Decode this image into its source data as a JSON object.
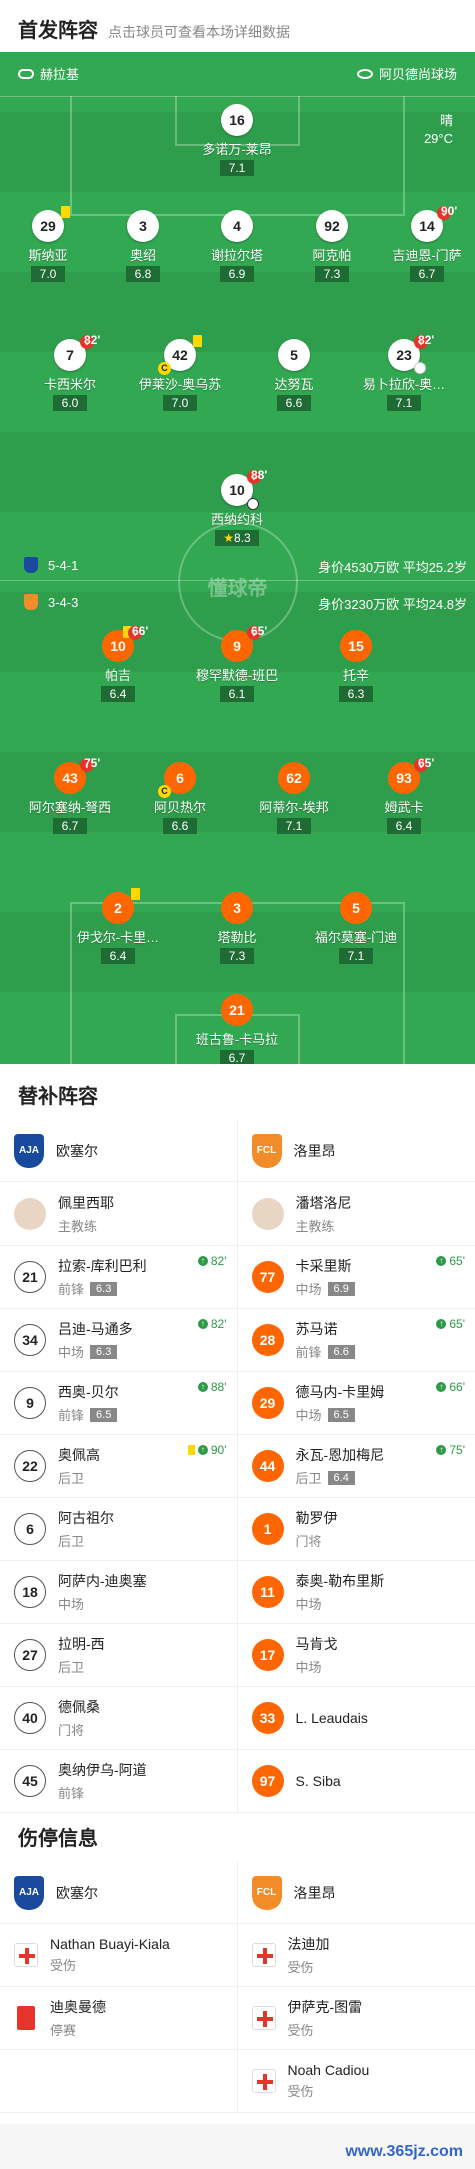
{
  "header": {
    "title": "首发阵容",
    "subtitle": "点击球员可查看本场详细数据"
  },
  "home_team": "赫拉基",
  "venue": "阿贝德尚球场",
  "weather": "晴",
  "temp": "29°C",
  "home_tactics": {
    "formation": "5-4-1",
    "value": "身价4530万欧 平均25.2岁"
  },
  "away_tactics": {
    "formation": "3-4-3",
    "value": "身价3230万欧 平均24.8岁"
  },
  "watermark_center": "懂球帝",
  "home_players": [
    {
      "num": "16",
      "name": "多诺万-莱昂",
      "rating": "7.1"
    },
    {
      "num": "29",
      "name": "斯纳亚",
      "rating": "7.0"
    },
    {
      "num": "3",
      "name": "奥绍",
      "rating": "6.8"
    },
    {
      "num": "4",
      "name": "谢拉尔塔",
      "rating": "6.9"
    },
    {
      "num": "92",
      "name": "阿克帕",
      "rating": "7.3"
    },
    {
      "num": "14",
      "name": "吉迪恩-门萨",
      "rating": "6.7",
      "minute": "90'"
    },
    {
      "num": "7",
      "name": "卡西米尔",
      "rating": "6.0",
      "minute": "82'"
    },
    {
      "num": "42",
      "name": "伊莱沙-奥乌苏",
      "rating": "7.0"
    },
    {
      "num": "5",
      "name": "达努瓦",
      "rating": "6.6"
    },
    {
      "num": "23",
      "name": "易卜拉欣-奥…",
      "rating": "7.1",
      "minute": "82'"
    },
    {
      "num": "10",
      "name": "西纳约科",
      "rating": "8.3",
      "minute": "88'"
    }
  ],
  "away_players": [
    {
      "num": "10",
      "name": "帕吉",
      "rating": "6.4",
      "minute": "66'"
    },
    {
      "num": "9",
      "name": "穆罕默德-班巴",
      "rating": "6.1",
      "minute": "65'"
    },
    {
      "num": "15",
      "name": "托辛",
      "rating": "6.3"
    },
    {
      "num": "43",
      "name": "阿尔塞纳-弩西",
      "rating": "6.7",
      "minute": "75'"
    },
    {
      "num": "6",
      "name": "阿贝热尔",
      "rating": "6.6"
    },
    {
      "num": "62",
      "name": "阿蒂尔-埃邦",
      "rating": "7.1"
    },
    {
      "num": "93",
      "name": "姆武卡",
      "rating": "6.4",
      "minute": "65'"
    },
    {
      "num": "2",
      "name": "伊戈尔-卡里…",
      "rating": "6.4"
    },
    {
      "num": "3",
      "name": "塔勒比",
      "rating": "7.3"
    },
    {
      "num": "5",
      "name": "福尔莫塞-门迪",
      "rating": "7.1"
    },
    {
      "num": "21",
      "name": "班古鲁-卡马拉",
      "rating": "6.7"
    }
  ],
  "bench": {
    "title": "替补阵容",
    "home_name": "欧塞尔",
    "away_name": "洛里昂",
    "home_coach": "佩里西耶",
    "away_coach": "潘塔洛尼",
    "coach_label": "主教练",
    "rows": [
      {
        "l": {
          "num": "21",
          "name": "拉索-库利巴利",
          "pos": "前锋",
          "rating": "6.3",
          "min": "82'"
        },
        "r": {
          "num": "77",
          "name": "卡采里斯",
          "pos": "中场",
          "rating": "6.9",
          "min": "65'"
        }
      },
      {
        "l": {
          "num": "34",
          "name": "吕迪-马通多",
          "pos": "中场",
          "rating": "6.3",
          "min": "82'"
        },
        "r": {
          "num": "28",
          "name": "苏马诺",
          "pos": "前锋",
          "rating": "6.6",
          "min": "65'"
        }
      },
      {
        "l": {
          "num": "9",
          "name": "西奥-贝尔",
          "pos": "前锋",
          "rating": "6.5",
          "min": "88'"
        },
        "r": {
          "num": "29",
          "name": "德马内-卡里姆",
          "pos": "中场",
          "rating": "6.5",
          "min": "66'"
        }
      },
      {
        "l": {
          "num": "22",
          "name": "奥佩高",
          "pos": "后卫",
          "rating": "",
          "min": "90'"
        },
        "r": {
          "num": "44",
          "name": "永瓦-恩加梅尼",
          "pos": "后卫",
          "rating": "6.4",
          "min": "75'"
        }
      },
      {
        "l": {
          "num": "6",
          "name": "阿古祖尔",
          "pos": "后卫",
          "rating": "",
          "min": ""
        },
        "r": {
          "num": "1",
          "name": "勒罗伊",
          "pos": "门将",
          "rating": "",
          "min": ""
        }
      },
      {
        "l": {
          "num": "18",
          "name": "阿萨内-迪奥塞",
          "pos": "中场",
          "rating": "",
          "min": ""
        },
        "r": {
          "num": "11",
          "name": "泰奥-勒布里斯",
          "pos": "中场",
          "rating": "",
          "min": ""
        }
      },
      {
        "l": {
          "num": "27",
          "name": "拉明-西",
          "pos": "后卫",
          "rating": "",
          "min": ""
        },
        "r": {
          "num": "17",
          "name": "马肯戈",
          "pos": "中场",
          "rating": "",
          "min": ""
        }
      },
      {
        "l": {
          "num": "40",
          "name": "德佩桑",
          "pos": "门将",
          "rating": "",
          "min": ""
        },
        "r": {
          "num": "33",
          "name": "L. Leaudais",
          "pos": "",
          "rating": "",
          "min": ""
        }
      },
      {
        "l": {
          "num": "45",
          "name": "奥纳伊乌-阿道",
          "pos": "前锋",
          "rating": "",
          "min": ""
        },
        "r": {
          "num": "97",
          "name": "S. Siba",
          "pos": "",
          "rating": "",
          "min": ""
        }
      }
    ]
  },
  "injury": {
    "title": "伤停信息",
    "home_name": "欧塞尔",
    "away_name": "洛里昂",
    "rows": [
      {
        "l": {
          "name": "Nathan Buayi-Kiala",
          "status": "受伤",
          "type": "injury"
        },
        "r": {
          "name": "法迪加",
          "status": "受伤",
          "type": "injury"
        }
      },
      {
        "l": {
          "name": "迪奥曼德",
          "status": "停赛",
          "type": "suspend"
        },
        "r": {
          "name": "伊萨克-图雷",
          "status": "受伤",
          "type": "injury"
        }
      },
      {
        "l": null,
        "r": {
          "name": "Noah Cadiou",
          "status": "受伤",
          "type": "injury"
        }
      }
    ]
  },
  "watermark": "www.365jz.com"
}
